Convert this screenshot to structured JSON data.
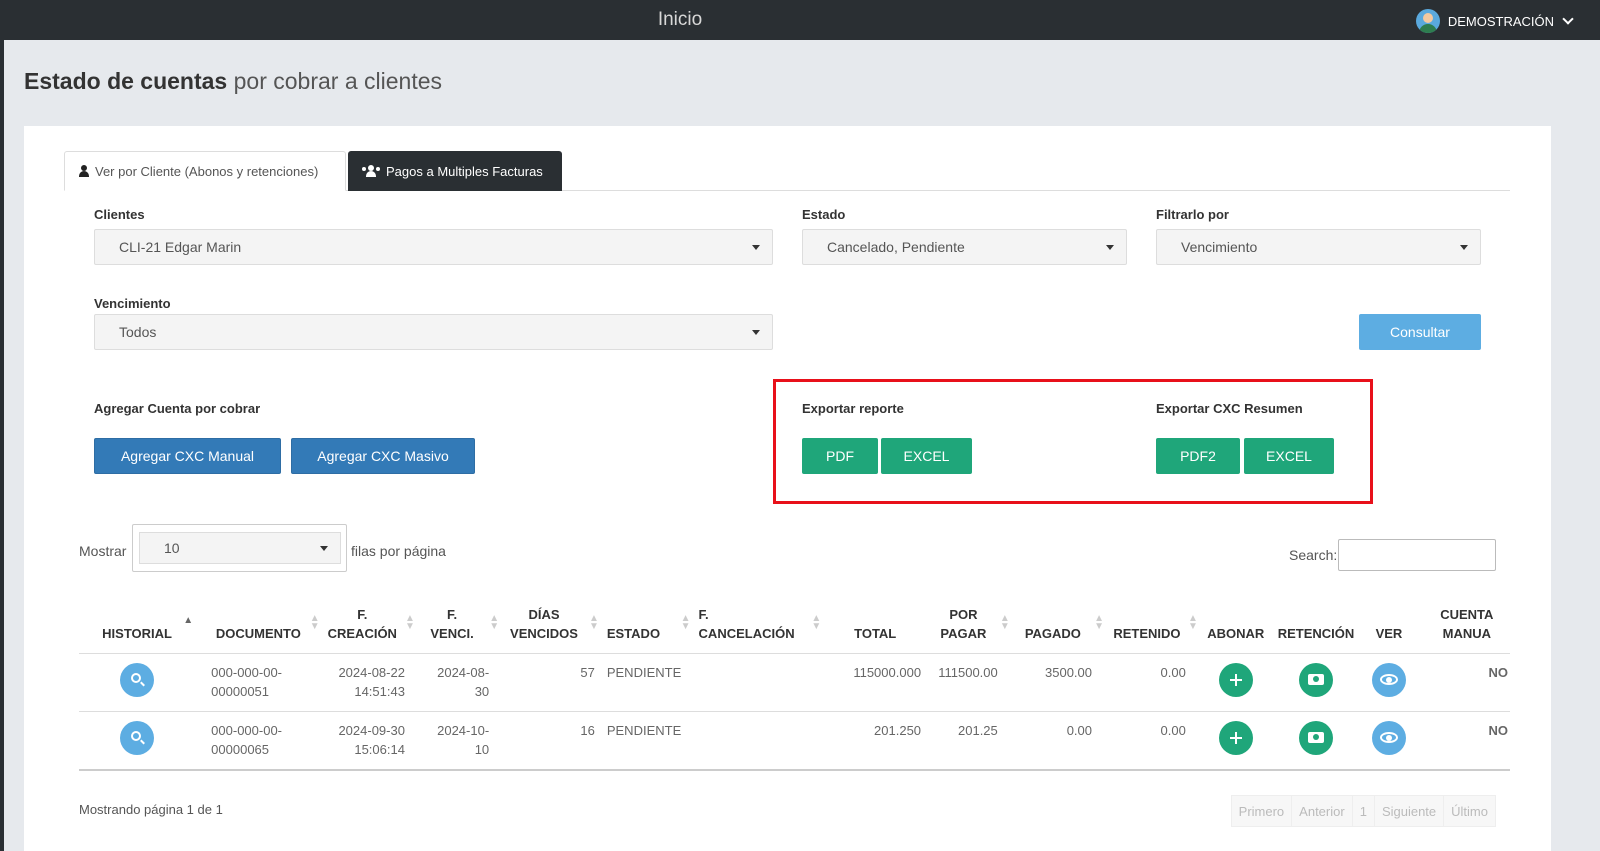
{
  "topbar": {
    "title": "Inicio",
    "user": "DEMOSTRACIÓN"
  },
  "page": {
    "title_bold": "Estado de cuentas",
    "title_light": "por cobrar a clientes"
  },
  "tabs": [
    {
      "label": "Ver por Cliente (Abonos y retenciones)",
      "icon": "user-icon"
    },
    {
      "label": "Pagos a Multiples Facturas",
      "icon": "users-icon"
    }
  ],
  "filters": {
    "clientes": {
      "label": "Clientes",
      "value": "CLI-21 Edgar Marin"
    },
    "estado": {
      "label": "Estado",
      "value": "Cancelado, Pendiente"
    },
    "filtrarlo": {
      "label": "Filtrarlo por",
      "value": "Vencimiento"
    },
    "vencimiento": {
      "label": "Vencimiento",
      "value": "Todos"
    },
    "consultar": "Consultar"
  },
  "agregar": {
    "label": "Agregar Cuenta por cobrar",
    "manual": "Agregar CXC Manual",
    "masivo": "Agregar CXC Masivo"
  },
  "exportar": {
    "label": "Exportar reporte",
    "pdf": "PDF",
    "excel": "EXCEL"
  },
  "resumen": {
    "label": "Exportar CXC Resumen",
    "pdf2": "PDF2",
    "excel": "EXCEL"
  },
  "table_controls": {
    "show_label": "Mostrar",
    "page_size": "10",
    "rows_label": "filas por página",
    "search_label": "Search:"
  },
  "columns": {
    "historial": "HISTORIAL",
    "documento": "DOCUMENTO",
    "f_creacion_1": "F.",
    "f_creacion_2": "CREACIÓN",
    "f_venci_1": "F.",
    "f_venci_2": "VENCI.",
    "dias_1": "DÍAS",
    "dias_2": "VENCIDOS",
    "estado": "ESTADO",
    "f_cancel_1": "F.",
    "f_cancel_2": "CANCELACIÓN",
    "total": "TOTAL",
    "por_pagar_1": "POR",
    "por_pagar_2": "PAGAR",
    "pagado": "PAGADO",
    "retenido": "RETENIDO",
    "abonar": "ABONAR",
    "retencion": "RETENCIÓN",
    "ver": "VER",
    "cuenta_1": "CUENTA",
    "cuenta_2": "MANUA"
  },
  "rows": [
    {
      "doc_1": "000-000-00-",
      "doc_2": "00000051",
      "creacion_1": "2024-08-22",
      "creacion_2": "14:51:43",
      "venci_1": "2024-08-",
      "venci_2": "30",
      "dias": "57",
      "estado": "PENDIENTE",
      "cancelacion": "",
      "total": "115000.000",
      "por_pagar": "111500.00",
      "pagado": "3500.00",
      "retenido": "0.00",
      "cuenta_manual": "NO"
    },
    {
      "doc_1": "000-000-00-",
      "doc_2": "00000065",
      "creacion_1": "2024-09-30",
      "creacion_2": "15:06:14",
      "venci_1": "2024-10-",
      "venci_2": "10",
      "dias": "16",
      "estado": "PENDIENTE",
      "cancelacion": "",
      "total": "201.250",
      "por_pagar": "201.25",
      "pagado": "0.00",
      "retenido": "0.00",
      "cuenta_manual": "NO"
    }
  ],
  "footer": {
    "info": "Mostrando página 1 de 1",
    "pager": [
      "Primero",
      "Anterior",
      "1",
      "Siguiente",
      "Último"
    ]
  },
  "colors": {
    "accent_green": "#1fa67a",
    "accent_blue": "#337ab7",
    "highlight_red": "#e8101a",
    "topbar": "#2a2f33"
  }
}
